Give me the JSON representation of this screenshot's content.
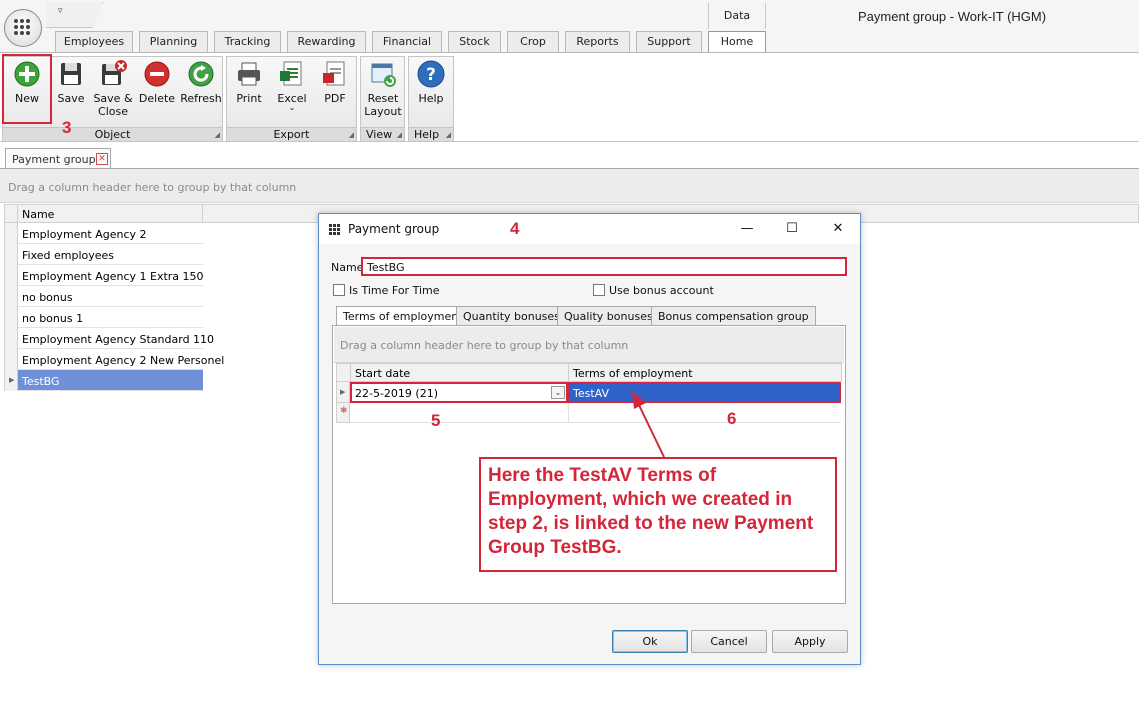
{
  "app": {
    "title": "Payment group - Work-IT (HGM)",
    "context_tab": "Data",
    "tabs": [
      "Employees",
      "Planning",
      "Tracking",
      "Rewarding",
      "Financial",
      "Stock",
      "Crop",
      "Reports",
      "Support",
      "Home"
    ],
    "active_tab": "Home"
  },
  "ribbon": {
    "object": {
      "label": "Object",
      "new": "New",
      "save": "Save",
      "save_close_1": "Save &",
      "save_close_2": "Close",
      "delete": "Delete",
      "refresh": "Refresh"
    },
    "export": {
      "label": "Export",
      "print": "Print",
      "excel": "Excel",
      "pdf": "PDF"
    },
    "view": {
      "label": "View",
      "reset_1": "Reset",
      "reset_2": "Layout"
    },
    "help": {
      "label": "Help",
      "help": "Help"
    }
  },
  "doc_tab": {
    "label": "Payment group"
  },
  "main_grid": {
    "group_hint": "Drag a column header here to group by that column",
    "column": "Name",
    "rows": [
      "Employment Agency 2",
      "Fixed employees",
      "Employment Agency 1 Extra 150",
      "no bonus",
      "no bonus 1",
      "Employment Agency Standard 110",
      "Employment Agency 2 New Personel",
      "TestBG"
    ],
    "selected_index": 7
  },
  "dialog": {
    "title": "Payment group",
    "name_label": "Name",
    "name_value": "TestBG",
    "is_time_for_time": "Is Time For Time",
    "use_bonus_account": "Use bonus account",
    "tabs": [
      "Terms of employment",
      "Quantity bonuses",
      "Quality bonuses",
      "Bonus compensation group"
    ],
    "active_tab": "Terms of employment",
    "group_hint": "Drag a column header here to group by that column",
    "columns": [
      "Start date",
      "Terms of employment"
    ],
    "row": {
      "start_date": "22-5-2019 (21)",
      "terms": "TestAV"
    },
    "ok": "Ok",
    "cancel": "Cancel",
    "apply": "Apply"
  },
  "annotations": {
    "step3": "3",
    "step4": "4",
    "step5": "5",
    "step6": "6",
    "callout": "Here the TestAV Terms of Employment, which we created in step 2, is linked to the new Payment Group TestBG.",
    "color": "#d4263b"
  }
}
